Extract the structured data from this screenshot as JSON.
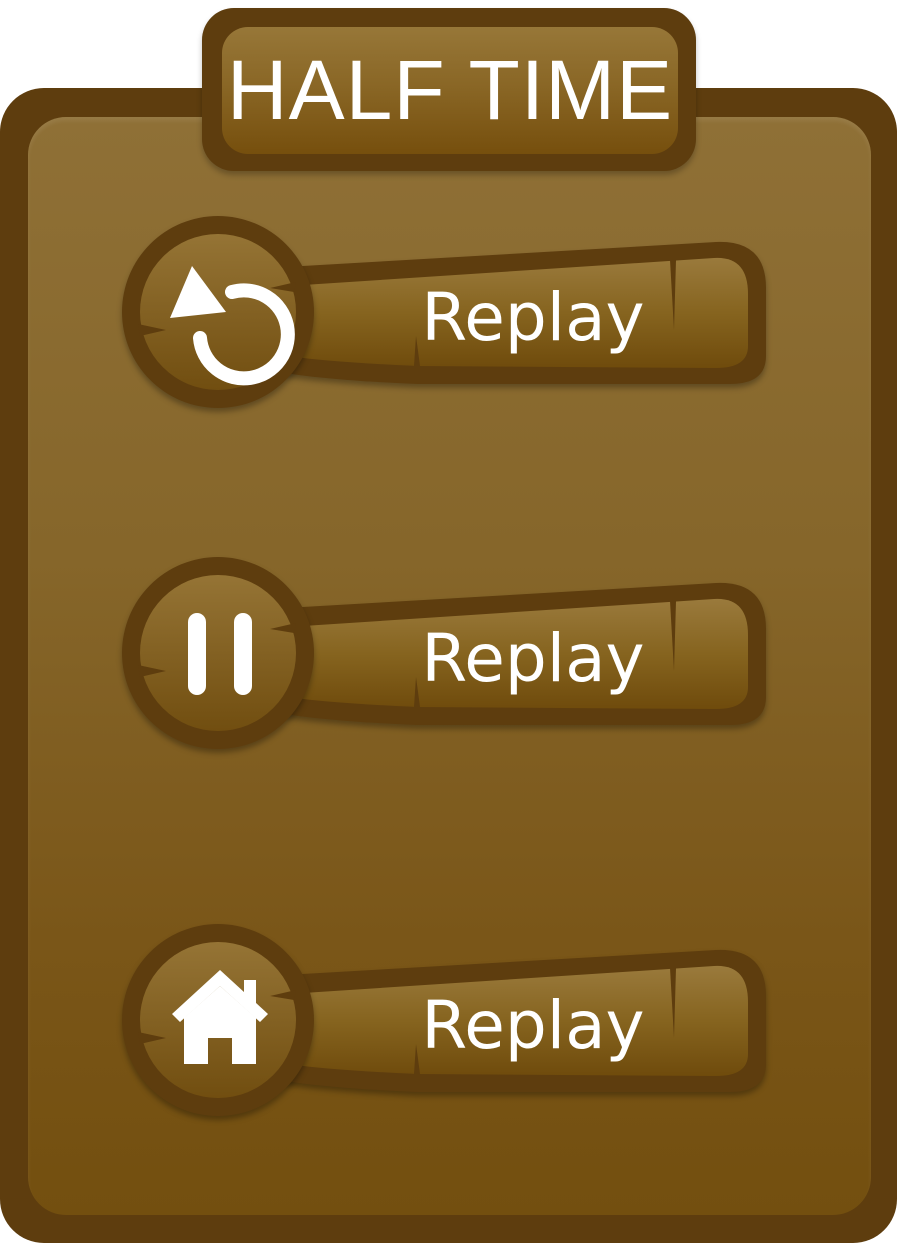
{
  "dialog": {
    "title": "HALF TIME"
  },
  "menu": {
    "items": [
      {
        "label": "Replay",
        "icon": "replay-icon"
      },
      {
        "label": "Replay",
        "icon": "pause-icon"
      },
      {
        "label": "Replay",
        "icon": "home-icon"
      }
    ]
  },
  "colors": {
    "frame": "#5e3d0e",
    "panel_top": "#8f7036",
    "panel_bottom": "#734f0f",
    "text": "#ffffff"
  }
}
